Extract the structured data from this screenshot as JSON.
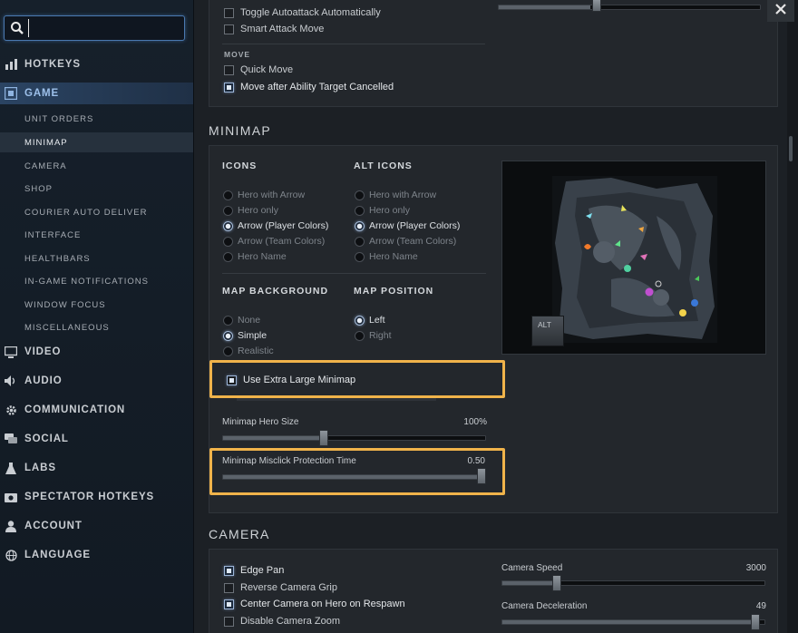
{
  "search": {
    "value": "",
    "placeholder": ""
  },
  "sidebar": {
    "categories": [
      {
        "label": "HOTKEYS"
      },
      {
        "label": "GAME"
      },
      {
        "label": "VIDEO"
      },
      {
        "label": "AUDIO"
      },
      {
        "label": "COMMUNICATION"
      },
      {
        "label": "SOCIAL"
      },
      {
        "label": "LABS"
      },
      {
        "label": "SPECTATOR HOTKEYS"
      },
      {
        "label": "ACCOUNT"
      },
      {
        "label": "LANGUAGE"
      }
    ],
    "game_sub": [
      {
        "label": "UNIT ORDERS"
      },
      {
        "label": "MINIMAP"
      },
      {
        "label": "CAMERA"
      },
      {
        "label": "SHOP"
      },
      {
        "label": "COURIER AUTO DELIVER"
      },
      {
        "label": "INTERFACE"
      },
      {
        "label": "HEALTHBARS"
      },
      {
        "label": "IN-GAME NOTIFICATIONS"
      },
      {
        "label": "WINDOW FOCUS"
      },
      {
        "label": "MISCELLANEOUS"
      }
    ]
  },
  "unit_orders": {
    "toggle_autoattack": "Toggle Autoattack Automatically",
    "smart_attack_move": "Smart Attack Move",
    "move_heading": "MOVE",
    "quick_move": "Quick Move",
    "move_after_ability": "Move after Ability Target Cancelled"
  },
  "minimap": {
    "title": "MINIMAP",
    "icons_heading": "ICONS",
    "alt_icons_heading": "ALT ICONS",
    "icon_options": [
      "Hero with Arrow",
      "Hero only",
      "Arrow (Player Colors)",
      "Arrow (Team Colors)",
      "Hero Name"
    ],
    "icons_selected": "Arrow (Player Colors)",
    "alt_icons_selected": "Arrow (Player Colors)",
    "background_heading": "MAP BACKGROUND",
    "background_options": [
      "None",
      "Simple",
      "Realistic"
    ],
    "background_selected": "Simple",
    "position_heading": "MAP POSITION",
    "position_options": [
      "Left",
      "Right"
    ],
    "position_selected": "Left",
    "use_extra_large": "Use Extra Large Minimap",
    "hero_size_label": "Minimap Hero Size",
    "hero_size_value": "100%",
    "hero_size_fraction": 0.38,
    "misclick_label": "Minimap Misclick Protection Time",
    "misclick_value": "0.50",
    "misclick_fraction": 1.0,
    "alt_key_label": "ALT",
    "highlight_color": "#f0b34a"
  },
  "camera": {
    "title": "CAMERA",
    "edge_pan": "Edge Pan",
    "reverse_grip": "Reverse Camera Grip",
    "center_on_respawn": "Center Camera on Hero on Respawn",
    "disable_zoom": "Disable Camera Zoom",
    "speed_label": "Camera Speed",
    "speed_value": "3000",
    "speed_fraction": 0.2,
    "decel_label": "Camera Deceleration",
    "decel_value": "49",
    "decel_fraction": 0.98
  }
}
